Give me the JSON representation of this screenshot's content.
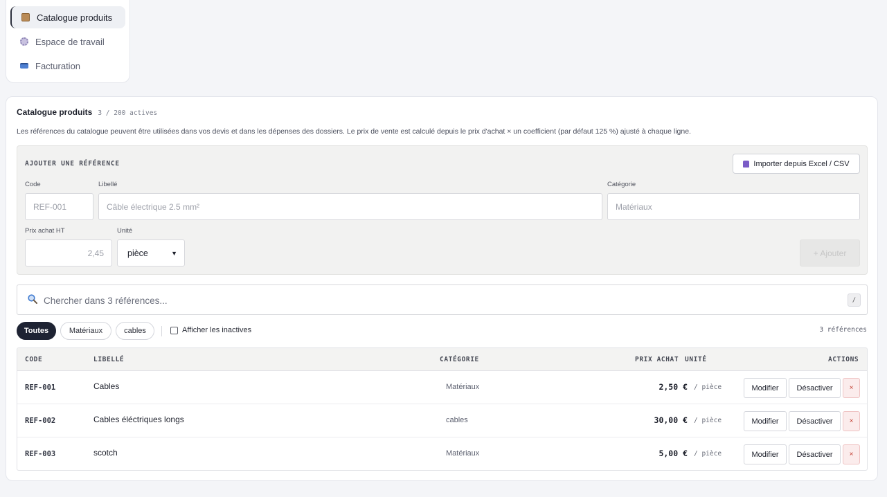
{
  "sidebar": {
    "items": [
      {
        "label": "Catalogue produits",
        "icon": "package-icon",
        "active": true
      },
      {
        "label": "Espace de travail",
        "icon": "gear-icon",
        "active": false
      },
      {
        "label": "Facturation",
        "icon": "credit-card-icon",
        "active": false
      }
    ]
  },
  "header": {
    "title": "Catalogue produits",
    "count": "3 / 200 actives",
    "description": "Les références du catalogue peuvent être utilisées dans vos devis et dans les dépenses des dossiers. Le prix de vente est calculé depuis le prix d'achat × un coefficient (par défaut 125 %) ajusté à chaque ligne."
  },
  "add_panel": {
    "title": "AJOUTER UNE RÉFÉRENCE",
    "import_label": "Importer depuis Excel / CSV",
    "code_label": "Code",
    "code_placeholder": "REF-001",
    "libelle_label": "Libellé",
    "libelle_placeholder": "Câble électrique 2.5 mm²",
    "categorie_label": "Catégorie",
    "categorie_placeholder": "Matériaux",
    "prix_label": "Prix achat HT",
    "prix_placeholder": "2,45",
    "unite_label": "Unité",
    "unite_value": "pièce",
    "add_label": "+ Ajouter"
  },
  "search": {
    "placeholder": "Chercher dans 3 références...",
    "shortcut": "/"
  },
  "filters": {
    "chips": [
      "Toutes",
      "Matériaux",
      "cables"
    ],
    "active": "Toutes",
    "show_inactive_label": "Afficher les inactives",
    "ref_count": "3 références"
  },
  "table": {
    "headers": {
      "code": "CODE",
      "libelle": "LIBELLÉ",
      "categorie": "CATÉGORIE",
      "prix": "PRIX ACHAT",
      "unite": "UNITÉ",
      "actions": "ACTIONS"
    },
    "rows": [
      {
        "code": "REF-001",
        "libelle": "Cables",
        "categorie": "Matériaux",
        "prix": "2,50 €",
        "unite": "/ pièce"
      },
      {
        "code": "REF-002",
        "libelle": "Cables éléctriques longs",
        "categorie": "cables",
        "prix": "30,00 €",
        "unite": "/ pièce"
      },
      {
        "code": "REF-003",
        "libelle": "scotch",
        "categorie": "Matériaux",
        "prix": "5,00 €",
        "unite": "/ pièce"
      }
    ],
    "modify_label": "Modifier",
    "deactivate_label": "Désactiver",
    "delete_label": "×"
  },
  "colors": {
    "accent_dark": "#1e2333",
    "delete_red": "#c0392b"
  }
}
